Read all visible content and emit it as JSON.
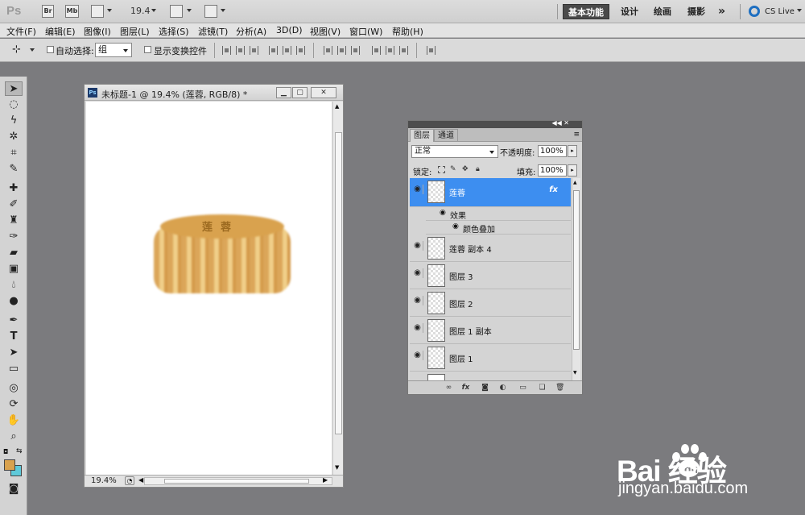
{
  "app": {
    "logo": "Ps",
    "chips": [
      "Br",
      "Mb"
    ],
    "zoom_value": "19.4",
    "workspaces": [
      "基本功能",
      "设计",
      "绘画",
      "摄影"
    ],
    "more": "»",
    "cslive": "CS Live"
  },
  "menu": [
    "文件(F)",
    "编辑(E)",
    "图像(I)",
    "图层(L)",
    "选择(S)",
    "滤镜(T)",
    "分析(A)",
    "3D(D)",
    "视图(V)",
    "窗口(W)",
    "帮助(H)"
  ],
  "options": {
    "auto_select_label": "自动选择:",
    "auto_select_value": "组",
    "show_transform_label": "显示变换控件"
  },
  "document": {
    "title": "未标题-1 @ 19.4% (莲蓉, RGB/8) *",
    "zoom": "19.4%",
    "cake_text": "莲蓉"
  },
  "layers_panel": {
    "tabs": [
      "图层",
      "通道"
    ],
    "blend_mode": "正常",
    "opacity_label": "不透明度:",
    "opacity_value": "100%",
    "lock_label": "锁定:",
    "fill_label": "填充:",
    "fill_value": "100%",
    "layers": [
      {
        "name": "莲蓉",
        "selected": true,
        "fx": "fx"
      },
      {
        "name": "莲蓉 副本 4",
        "selected": false
      },
      {
        "name": "图层 3",
        "selected": false
      },
      {
        "name": "图层 2",
        "selected": false
      },
      {
        "name": "图层 1 副本",
        "selected": false
      },
      {
        "name": "图层 1",
        "selected": false
      }
    ],
    "effects_label": "效果",
    "color_overlay_label": "颜色叠加"
  },
  "colors": {
    "foreground": "#d9a24e",
    "background": "#5fc9d9",
    "selection": "#3d8ef0",
    "active_workspace": "#4a4a4a"
  },
  "watermark": {
    "main": "Bai  经验",
    "sub": "jingyan.baidu.com"
  }
}
